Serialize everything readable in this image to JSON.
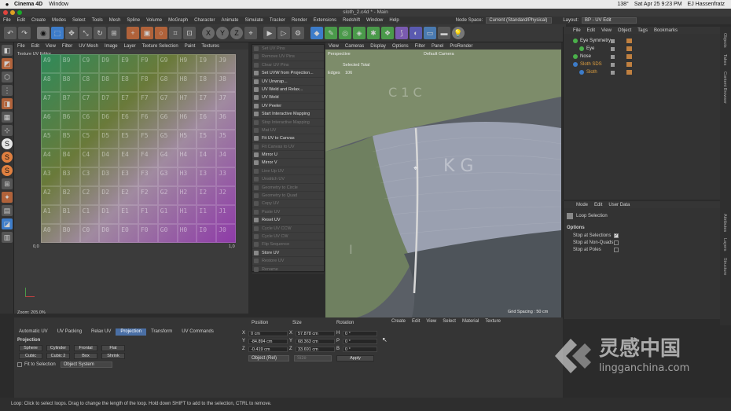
{
  "mac_menu": {
    "apple": "",
    "app": "Cinema 4D",
    "items": [
      "Window"
    ],
    "battery": "138°",
    "date": "Sat Apr 25  9:23 PM",
    "user": "EJ Hassenfratz"
  },
  "window_title": "sloth_2.c4d * - Main",
  "c4d_menu": [
    "File",
    "Edit",
    "Create",
    "Modes",
    "Select",
    "Tools",
    "Mesh",
    "Spline",
    "Volume",
    "MoGraph",
    "Character",
    "Animate",
    "Simulate",
    "Tracker",
    "Render",
    "Extensions",
    "Redshift",
    "Window",
    "Help"
  ],
  "node_space": {
    "label": "Node Space:",
    "value": "Current (Standard/Physical)",
    "layout_label": "Layout:",
    "layout_value": "BP - UV Edit"
  },
  "uv_editor": {
    "menu": [
      "File",
      "Edit",
      "View",
      "Filter",
      "UV Mesh",
      "Image",
      "Layer",
      "Texture Selection",
      "Paint",
      "Textures"
    ],
    "title": "Texture UV Editor",
    "zoom": "Zoom: 205.0%",
    "axis_left": "0,0",
    "axis_right": "1,0",
    "grid_labels": [
      "A0",
      "B0",
      "C0",
      "D0",
      "E0",
      "F0",
      "G0",
      "H0",
      "I0",
      "J0",
      "A1",
      "B1",
      "C1",
      "D1",
      "E1",
      "F1",
      "G1",
      "H1",
      "I1",
      "J1"
    ]
  },
  "context_menu": {
    "items": [
      {
        "label": "Set UV Pins",
        "enabled": false
      },
      {
        "label": "Remove UV Pins",
        "enabled": false
      },
      {
        "label": "Clear UV Pins",
        "enabled": false
      },
      {
        "label": "Set UVW from Projection...",
        "enabled": true
      },
      {
        "label": "UV Unwrap...",
        "enabled": true
      },
      {
        "label": "UV Weld and Relax...",
        "enabled": true
      },
      {
        "label": "UV Weld",
        "enabled": true
      },
      {
        "label": "UV Peeler",
        "enabled": true
      },
      {
        "label": "Start Interactive Mapping",
        "enabled": true
      },
      {
        "label": "Stop Interactive Mapping",
        "enabled": false
      },
      {
        "label": "Mat UV",
        "enabled": false
      },
      {
        "label": "Fit UV to Canvas",
        "enabled": true
      },
      {
        "label": "Fit Canvas to UV",
        "enabled": false
      },
      {
        "label": "Mirror U",
        "enabled": true
      },
      {
        "label": "Mirror V",
        "enabled": true
      },
      {
        "label": "Line Up UV",
        "enabled": false
      },
      {
        "label": "Unstitch UV",
        "enabled": false
      },
      {
        "label": "Geometry to Circle",
        "enabled": false
      },
      {
        "label": "Geometry to Quad",
        "enabled": false
      },
      {
        "label": "Copy UV",
        "enabled": false
      },
      {
        "label": "Paste UV",
        "enabled": false
      },
      {
        "label": "Reset UV",
        "enabled": true
      },
      {
        "label": "Cycle UV CCW",
        "enabled": false
      },
      {
        "label": "Cycle UV CW",
        "enabled": false
      },
      {
        "label": "Flip Sequence",
        "enabled": false
      },
      {
        "label": "Store UV",
        "enabled": true
      },
      {
        "label": "Restore UV",
        "enabled": false
      },
      {
        "label": "Rename",
        "enabled": false
      }
    ]
  },
  "viewport": {
    "menu": [
      "View",
      "Cameras",
      "Display",
      "Options",
      "Filter",
      "Panel",
      "ProRender"
    ],
    "label": "Perspective",
    "camera": "Default Camera",
    "stats_label": "Selected Total",
    "edges_label": "Edges",
    "edges_value": "106",
    "grid_spacing": "Grid Spacing : 50 cm"
  },
  "objects": {
    "menu": [
      "File",
      "Edit",
      "View",
      "Object",
      "Tags",
      "Bookmarks"
    ],
    "items": [
      {
        "name": "Eye Symmetry",
        "indent": 0,
        "color": "#dcdcdc"
      },
      {
        "name": "Eye",
        "indent": 1,
        "color": "#dcdcdc"
      },
      {
        "name": "Nose",
        "indent": 0,
        "color": "#dcdcdc"
      },
      {
        "name": "Sloth SDS",
        "indent": 0,
        "color": "#e0a040"
      },
      {
        "name": "Sloth",
        "indent": 1,
        "color": "#e0a040"
      }
    ]
  },
  "attributes": {
    "menu": [
      "Mode",
      "Edit",
      "User Data"
    ],
    "tool": "Loop Selection",
    "section": "Options",
    "opts": [
      {
        "label": "Stop at Selections",
        "checked": true
      },
      {
        "label": "Stop at Non-Quads",
        "checked": false
      },
      {
        "label": "Stop at Poles",
        "checked": false
      }
    ]
  },
  "right_tabs": [
    "Objects",
    "Takes",
    "Content Browser",
    "Attributes",
    "Layers",
    "Structure"
  ],
  "uv_tools": {
    "tabs": [
      "Automatic UV",
      "UV Packing",
      "Relax UV",
      "Projection",
      "Transform",
      "UV Commands"
    ],
    "active_tab": "Projection",
    "section": "Projection",
    "buttons": [
      "Sphere",
      "Cylinder",
      "Frontal",
      "Flat",
      "Cubic",
      "Cubic 2",
      "Box",
      "Shrink"
    ],
    "fit_label": "Fit to Selection",
    "system": "Object System"
  },
  "coords": {
    "headers": [
      "Position",
      "Size",
      "Rotation"
    ],
    "rows": [
      {
        "axis": "X",
        "pos": "0 cm",
        "size": "57.878 cm",
        "rot_axis": "H",
        "rot": "0 °"
      },
      {
        "axis": "Y",
        "pos": "-84.894 cm",
        "size": "68.363 cm",
        "rot_axis": "P",
        "rot": "0 °"
      },
      {
        "axis": "Z",
        "pos": "-0.419 cm",
        "size": "33.691 cm",
        "rot_axis": "B",
        "rot": "0 °"
      }
    ],
    "mode": "Object (Rel)",
    "size_mode": "Size",
    "apply": "Apply"
  },
  "materials": {
    "menu": [
      "Create",
      "Edit",
      "View",
      "Select",
      "Material",
      "Texture"
    ]
  },
  "watermark": {
    "cn": "灵感中国",
    "url": "lingganchina.com"
  },
  "status": "Loop: Click to select loops. Drag to change the length of the loop. Hold down SHIFT to add to the selection, CTRL to remove.",
  "colors": {
    "accent": "#3d7cc9",
    "active_tab": "#4a6fa5",
    "orange": "#e0a040"
  }
}
